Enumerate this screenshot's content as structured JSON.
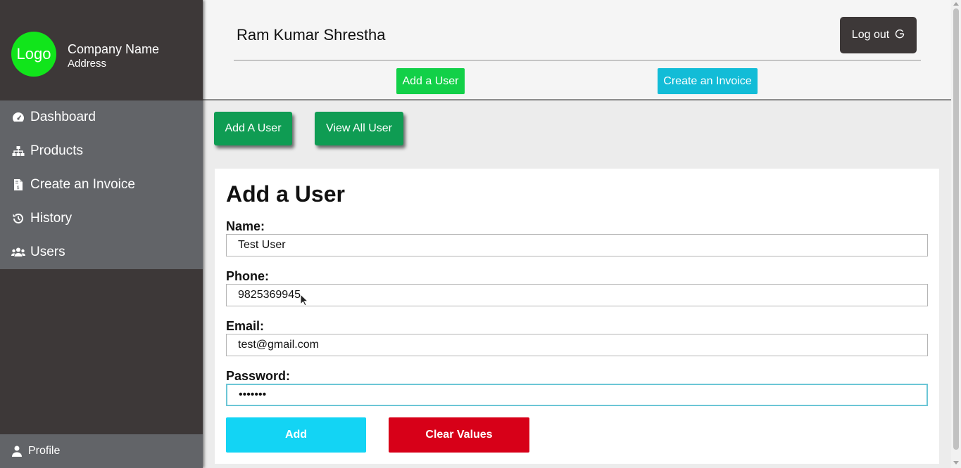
{
  "sidebar": {
    "logo_text": "Logo",
    "company_name": "Company Name",
    "company_address": "Address",
    "items": [
      {
        "label": "Dashboard",
        "icon": "dashboard-icon"
      },
      {
        "label": "Products",
        "icon": "sitemap-icon"
      },
      {
        "label": "Create an Invoice",
        "icon": "invoice-icon"
      },
      {
        "label": "History",
        "icon": "history-icon"
      },
      {
        "label": "Users",
        "icon": "users-icon"
      }
    ],
    "profile_label": "Profile"
  },
  "header": {
    "user_name": "Ram Kumar Shrestha",
    "logout_label": "Log out",
    "add_user_label": "Add a User",
    "create_invoice_label": "Create an Invoice"
  },
  "main": {
    "tabs": [
      {
        "label": "Add A User"
      },
      {
        "label": "View All User"
      }
    ],
    "form": {
      "title": "Add a User",
      "fields": [
        {
          "label": "Name:",
          "value": "Test User"
        },
        {
          "label": "Phone:",
          "value": "9825369945"
        },
        {
          "label": "Email:",
          "value": "test@gmail.com"
        },
        {
          "label": "Password:",
          "value": "•••••••"
        }
      ],
      "add_label": "Add",
      "clear_label": "Clear Values"
    }
  },
  "colors": {
    "sidebar_bg": "#3d3838",
    "menu_bg": "#626468",
    "logo_green": "#11e51b",
    "tab_green": "#0f9c53",
    "add_cyan": "#13d4f4",
    "clear_red": "#d70018"
  }
}
